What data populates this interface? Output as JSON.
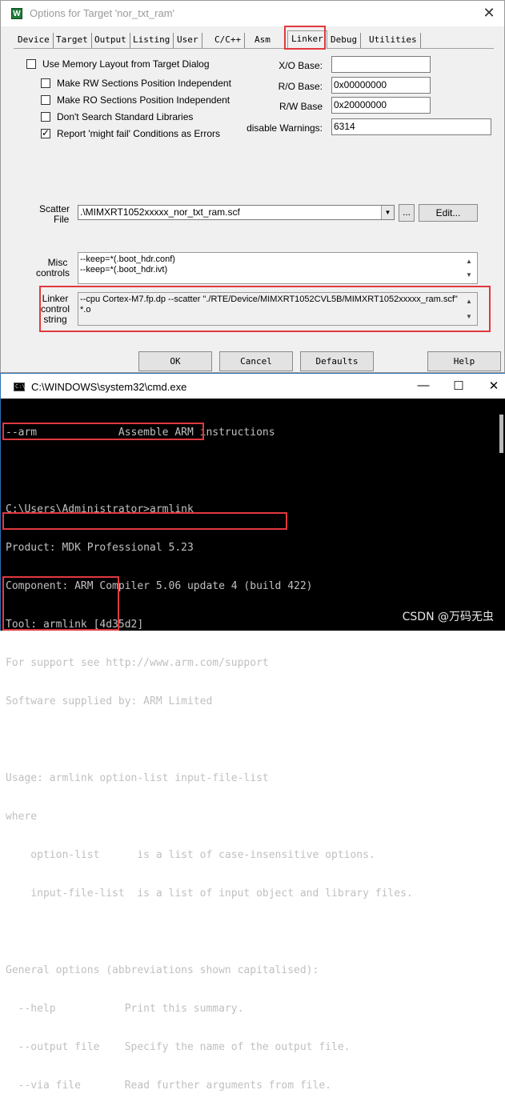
{
  "dialog": {
    "title": "Options for Target 'nor_txt_ram'",
    "close_glyph": "✕",
    "tabs": [
      "Device",
      "Target",
      "Output",
      "Listing",
      "User",
      "C/C++",
      "Asm",
      "Linker",
      "Debug",
      "Utilities"
    ],
    "active_tab": "Linker",
    "checkboxes": [
      {
        "label": "Use Memory Layout from Target Dialog",
        "checked": false
      },
      {
        "label": "Make RW Sections Position Independent",
        "checked": false
      },
      {
        "label": "Make RO Sections Position Independent",
        "checked": false
      },
      {
        "label": "Don't Search Standard Libraries",
        "checked": false
      },
      {
        "label": "Report 'might fail' Conditions as Errors",
        "checked": true
      }
    ],
    "fields": {
      "xo_base_label": "X/O Base:",
      "xo_base_value": "",
      "ro_base_label": "R/O Base:",
      "ro_base_value": "0x00000000",
      "rw_base_label": "R/W Base",
      "rw_base_value": "0x20000000",
      "disable_warnings_label": "disable Warnings:",
      "disable_warnings_value": "6314"
    },
    "scatter": {
      "label_line1": "Scatter",
      "label_line2": "File",
      "value": ".\\MIMXRT1052xxxxx_nor_txt_ram.scf",
      "browse_label": "...",
      "edit_label": "Edit..."
    },
    "misc": {
      "label_line1": "Misc",
      "label_line2": "controls",
      "lines": [
        "--keep=*(.boot_hdr.conf)",
        "--keep=*(.boot_hdr.ivt)"
      ]
    },
    "linker_control": {
      "label_line1": "Linker",
      "label_line2": "control",
      "label_line3": "string",
      "lines": [
        "--cpu Cortex-M7.fp.dp --scatter \"./RTE/Device/MIMXRT1052CVL5B/MIMXRT1052xxxxx_ram.scf\"",
        "*.o"
      ]
    },
    "buttons": {
      "ok": "OK",
      "cancel": "Cancel",
      "defaults": "Defaults",
      "help": "Help"
    }
  },
  "console": {
    "title": "C:\\WINDOWS\\system32\\cmd.exe",
    "icon_text": "C:\\",
    "minimize_glyph": "—",
    "maximize_glyph": "☐",
    "close_glyph": "✕",
    "lines": [
      "--arm             Assemble ARM instructions",
      "",
      "C:\\Users\\Administrator>armlink",
      "Product: MDK Professional 5.23",
      "Component: ARM Compiler 5.06 update 4 (build 422)",
      "Tool: armlink [4d35d2]",
      "For support see http://www.arm.com/support",
      "Software supplied by: ARM Limited",
      "",
      "Usage: armlink option-list input-file-list",
      "where",
      "    option-list      is a list of case-insensitive options.",
      "    input-file-list  is a list of input object and library files.",
      "",
      "General options (abbreviations shown capitalised):",
      "  --help           Print this summary.",
      "  --output file    Specify the name of the output file.",
      "  --via file       Read further arguments from file."
    ]
  },
  "watermark": "CSDN @万码无虫",
  "colors": {
    "highlight_box": "#e0393e",
    "console_bg": "#000000",
    "console_text": "#c0c0c0",
    "dialog_bg": "#f0f0f0"
  }
}
